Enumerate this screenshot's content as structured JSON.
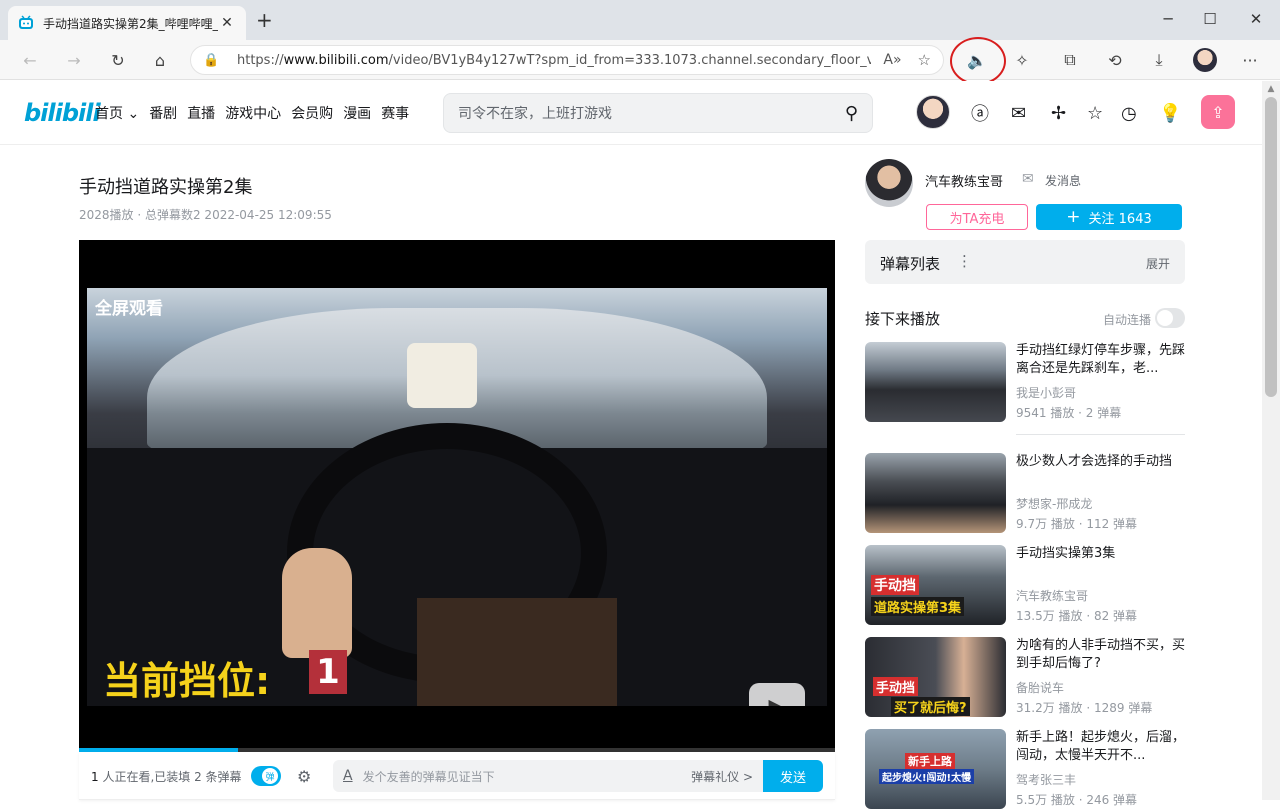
{
  "browser": {
    "tab_title": "手动挡道路实操第2集_哔哩哔哩_",
    "url_prefix": "https://",
    "url_host": "www.bilibili.com",
    "url_path": "/video/BV1yB4y127wT?spm_id_from=333.1073.channel.secondary_floor_vide..."
  },
  "site": {
    "logo": "bilibili",
    "nav": [
      "首页",
      "番剧",
      "直播",
      "游戏中心",
      "会员购",
      "漫画",
      "赛事"
    ],
    "search_placeholder": "司令不在家，上班打游戏"
  },
  "video": {
    "title": "手动挡道路实操第2集",
    "meta": "2028播放 · 总弹幕数2   2022-04-25 12:09:55",
    "overlay_fullscreen": "全屏观看",
    "overlay_gear": "当前挡位:",
    "overlay_gear_num": "1",
    "progress": 0.21
  },
  "danmaku_bar": {
    "viewers_prefix": "1",
    "viewers_text": " 人正在看,已装填 2 条弹幕",
    "toggle_label": "弹",
    "placeholder": "发个友善的弹幕见证当下",
    "etiquette": "弹幕礼仪 >",
    "send": "发送"
  },
  "uploader": {
    "name": "汽车教练宝哥",
    "message": "发消息",
    "charge": "为TA充电",
    "follow": "关注 1643"
  },
  "danmaku_list": {
    "title": "弹幕列表",
    "expand": "展开"
  },
  "up_next": {
    "title": "接下来播放",
    "autoplay": "自动连播",
    "items": [
      {
        "title": "手动挡红绿灯停车步骤，先踩离合还是先踩刹车，老...",
        "up": "我是小彭哥",
        "stats": "9541 播放 · 2 弹幕"
      },
      {
        "title": "极少数人才会选择的手动挡",
        "up": "梦想家-邢成龙",
        "stats": "9.7万 播放 · 112 弹幕"
      },
      {
        "title": "手动挡实操第3集",
        "up": "汽车教练宝哥",
        "stats": "13.5万 播放 · 82 弹幕"
      },
      {
        "title": "为啥有的人非手动挡不买，买到手却后悔了?",
        "up": "备胎说车",
        "stats": "31.2万 播放 · 1289 弹幕"
      },
      {
        "title": "新手上路！起步熄火，后溜，闯动，太慢半天开不...",
        "up": "驾考张三丰",
        "stats": "5.5万 播放 · 246 弹幕"
      }
    ],
    "thumb_labels": [
      "手动挡\n道路实操第3集",
      "手动挡\n买了就后悔?",
      "新手上路\n起步熄火!闯动!太慢"
    ]
  }
}
